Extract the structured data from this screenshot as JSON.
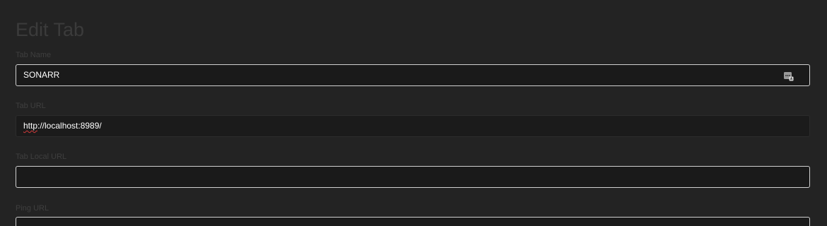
{
  "page": {
    "title": "Edit Tab"
  },
  "fields": {
    "tab_name": {
      "label": "Tab Name",
      "value": "SONARR"
    },
    "tab_url": {
      "label": "Tab URL",
      "value_spell": "http",
      "value_rest": "://localhost:8989/"
    },
    "tab_local_url": {
      "label": "Tab Local URL",
      "value": ""
    },
    "ping_url": {
      "label": "Ping URL",
      "value": ""
    }
  },
  "icons": {
    "autofill": "password-manager-icon"
  },
  "colors": {
    "background": "#232323",
    "field_background": "#1a1a1a",
    "field_border": "#d0d0d0",
    "label_text": "#3f3f3f",
    "spellcheck_underline": "#d23a3a"
  }
}
